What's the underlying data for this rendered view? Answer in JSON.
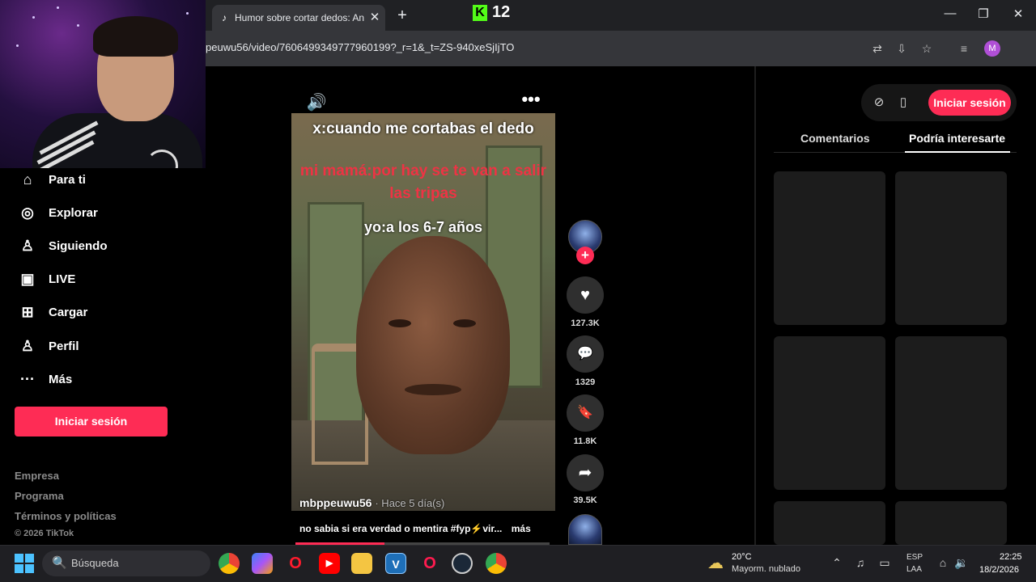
{
  "browser": {
    "tab_title": "Humor sobre cortar dedos: Ané",
    "tab_favicon": "♪",
    "tab_close": "✕",
    "new_tab": "+",
    "url": "peuwu56/video/7606499349777960199?_r=1&_t=ZS-940xeSjIjTO",
    "profile_initial": "M",
    "window_buttons": {
      "minimize": "—",
      "maximize": "❐",
      "close": "✕"
    },
    "toolbar_icons": [
      "translate-icon",
      "install-app-icon",
      "bookmark-star-icon",
      "media-controls-icon"
    ]
  },
  "kick_overlay": {
    "logo": "K",
    "viewers": "12"
  },
  "sidebar": {
    "items": [
      {
        "label": "Para ti",
        "icon": "⌂"
      },
      {
        "label": "Explorar",
        "icon": "◎"
      },
      {
        "label": "Siguiendo",
        "icon": "♙"
      },
      {
        "label": "LIVE",
        "icon": "▣"
      },
      {
        "label": "Cargar",
        "icon": "⊞"
      },
      {
        "label": "Perfil",
        "icon": "♙"
      },
      {
        "label": "Más",
        "icon": "···"
      }
    ],
    "login_button": "Iniciar sesión",
    "footer_links": [
      "Empresa",
      "Programa",
      "Términos y políticas"
    ],
    "copyright": "© 2026 TikTok"
  },
  "video": {
    "caption_line1": "x:cuando me cortabas el dedo",
    "caption_line2": "mi mamá:por hay se te van a salir las tripas",
    "caption_line3": "yo:a los 6-7 años",
    "author": "mbppeuwu56",
    "posted": "· Hace 5 día(s)",
    "description": "no sabia si era verdad o mentira #fyp⚡vir...",
    "more_label": "más",
    "progress": 0.35,
    "speaker_icon": "🔊",
    "menu_icon": "•••"
  },
  "actions": {
    "follow_icon": "+",
    "like": {
      "icon": "♥",
      "count": "127.3K"
    },
    "comment": {
      "icon": "💬",
      "count": "1329"
    },
    "save": {
      "icon": "🔖",
      "count": "11.8K"
    },
    "share": {
      "icon": "➦",
      "count": "39.5K"
    }
  },
  "right_panel": {
    "login_button": "Iniciar sesión",
    "tabs": [
      "Comentarios",
      "Podría interesarte"
    ],
    "active_tab": "Podría interesarte"
  },
  "taskbar": {
    "search_placeholder": "Búsqueda",
    "search_icon": "🔍",
    "apps": [
      "chrome-icon",
      "copilot-icon",
      "opera-icon",
      "youtube-icon",
      "file-explorer-icon",
      "visual-studio-icon",
      "opera-gx-icon",
      "steam-icon",
      "chrome-profile-icon"
    ],
    "weather_temp": "20°C",
    "weather_desc": "Mayorm. nublado",
    "lang_line1": "ESP",
    "lang_line2": "LAA",
    "time": "22:25",
    "date": "18/2/2026"
  }
}
